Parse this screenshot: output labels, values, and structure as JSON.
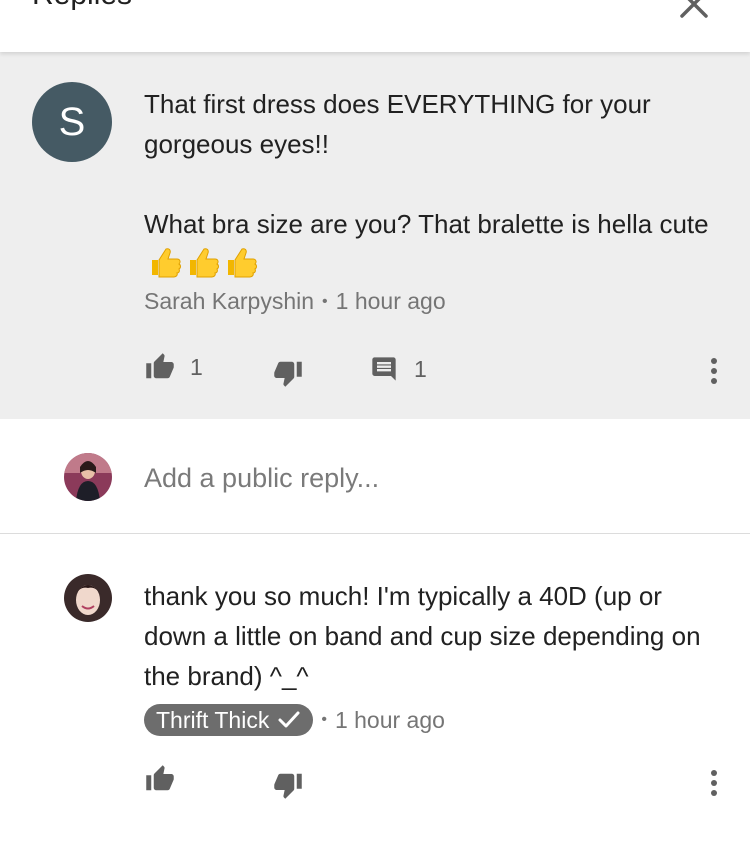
{
  "header": {
    "title": "Replies",
    "close_icon": "close-icon"
  },
  "parent_comment": {
    "avatar_letter": "S",
    "avatar_color": "#455a64",
    "text_line1": "That first dress does EVERYTHING for your gorgeous eyes!!",
    "text_line2": "What bra size are you? That bralette is hella cute",
    "emoji": "thumbs-up-emoji",
    "emoji_count": 3,
    "author": "Sarah Karpyshin",
    "time": "1 hour ago",
    "likes": "1",
    "replies": "1"
  },
  "reply_box": {
    "placeholder": "Add a public reply..."
  },
  "reply": {
    "text": "thank you so much! I'm typically a 40D (up or down a little on band and cup size depending on the brand) ^_^",
    "author": "Thrift Thick",
    "verified_icon": "checkmark-icon",
    "time": "1 hour ago"
  },
  "colors": {
    "background_parent": "#eeeeee",
    "badge": "#6d6d6d",
    "meta_text": "#757575"
  }
}
